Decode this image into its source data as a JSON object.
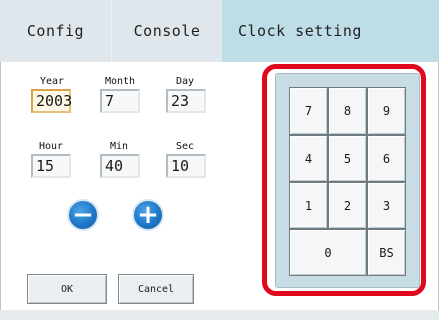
{
  "tabs": [
    {
      "label": "Config"
    },
    {
      "label": "Console"
    },
    {
      "label": "Clock setting"
    }
  ],
  "date": {
    "year_label": "Year",
    "year_value": "2003",
    "month_label": "Month",
    "month_value": "7",
    "day_label": "Day",
    "day_value": "23"
  },
  "time": {
    "hour_label": "Hour",
    "hour_value": "15",
    "min_label": "Min",
    "min_value": "40",
    "sec_label": "Sec",
    "sec_value": "10"
  },
  "stepper": {
    "minus_symbol": "−",
    "plus_symbol": "+"
  },
  "actions": {
    "ok_label": "OK",
    "cancel_label": "Cancel"
  },
  "keypad": {
    "keys": [
      "7",
      "8",
      "9",
      "4",
      "5",
      "6",
      "1",
      "2",
      "3",
      "0",
      "BS"
    ]
  },
  "colors": {
    "highlight": "#e0091b",
    "stepper": "#1f78c8",
    "active_tab": "#bfdde7"
  }
}
